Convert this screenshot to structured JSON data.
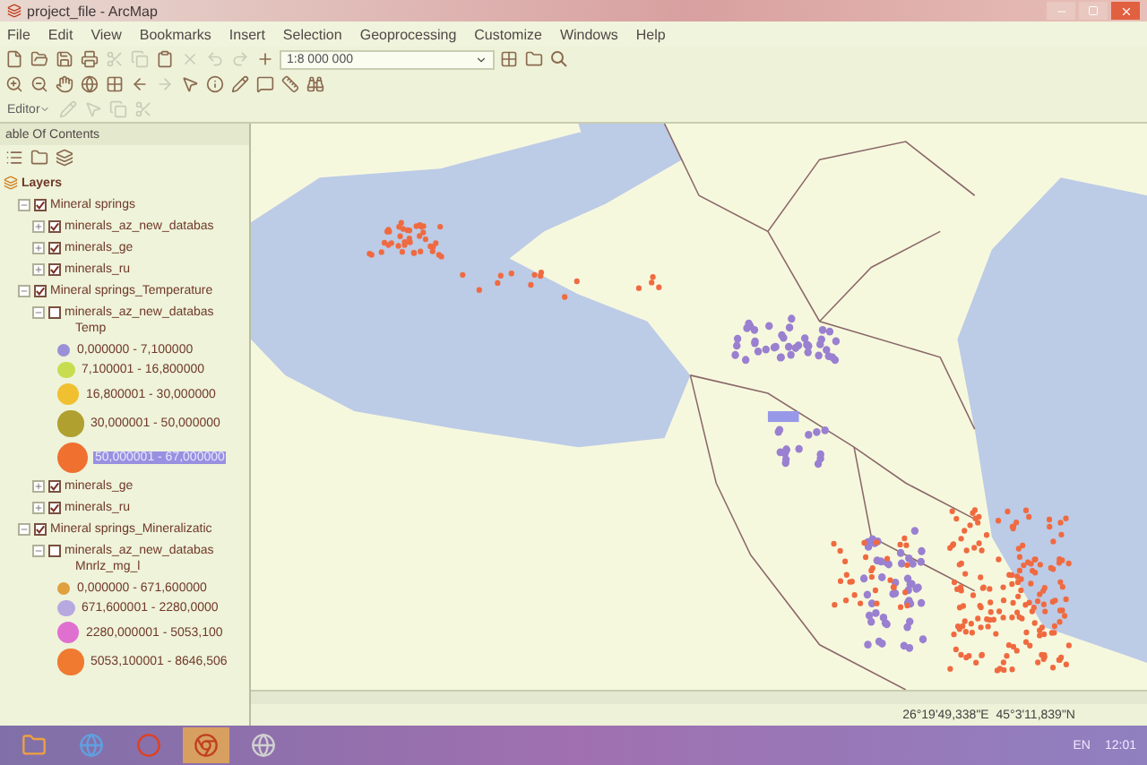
{
  "window": {
    "title": "project_file - ArcMap"
  },
  "menu": [
    "File",
    "Edit",
    "View",
    "Bookmarks",
    "Insert",
    "Selection",
    "Geoprocessing",
    "Customize",
    "Windows",
    "Help"
  ],
  "toolbar": {
    "scale": "1:8 000 000",
    "editor": "Editor"
  },
  "toc": {
    "title": "able Of Contents",
    "root": {
      "label": "Layers",
      "children": [
        {
          "label": "Mineral springs",
          "checked": true,
          "expanded": true,
          "children": [
            {
              "label": "minerals_az_new_databas",
              "checked": true,
              "expanded": false
            },
            {
              "label": "minerals_ge",
              "checked": true,
              "expanded": false
            },
            {
              "label": "minerals_ru",
              "checked": true,
              "expanded": false
            }
          ]
        },
        {
          "label": "Mineral springs_Temperature",
          "checked": true,
          "expanded": true,
          "children": [
            {
              "label": "minerals_az_new_databas",
              "checked": false,
              "expanded": true,
              "legend": {
                "field": "Temp",
                "classes": [
                  {
                    "label": "0,000000 - 7,100000",
                    "color": "#9a90d8",
                    "selected": false
                  },
                  {
                    "label": "7,100001 - 16,800000",
                    "color": "#c8dc50",
                    "selected": false
                  },
                  {
                    "label": "16,800001 - 30,000000",
                    "color": "#f0c030",
                    "selected": false
                  },
                  {
                    "label": "30,000001 - 50,000000",
                    "color": "#b0a030",
                    "selected": false
                  },
                  {
                    "label": "50,000001 - 67,000000",
                    "color": "#f07030",
                    "selected": true
                  }
                ]
              }
            },
            {
              "label": "minerals_ge",
              "checked": true,
              "expanded": false
            },
            {
              "label": "minerals_ru",
              "checked": true,
              "expanded": false
            }
          ]
        },
        {
          "label": "Mineral springs_Mineralizatic",
          "checked": true,
          "expanded": true,
          "children": [
            {
              "label": "minerals_az_new_databas",
              "checked": false,
              "expanded": true,
              "legend": {
                "field": "Mnrlz_mg_l",
                "classes": [
                  {
                    "label": "0,000000 - 671,600000",
                    "color": "#e0a040",
                    "selected": false
                  },
                  {
                    "label": "671,600001 - 2280,0000",
                    "color": "#b8a8e0",
                    "selected": false
                  },
                  {
                    "label": "2280,000001 - 5053,100",
                    "color": "#e070d0",
                    "selected": false
                  },
                  {
                    "label": "5053,100001 - 8646,506",
                    "color": "#f07a30",
                    "selected": false
                  }
                ]
              }
            }
          ]
        }
      ]
    }
  },
  "status": {
    "coordinates": "26°19'49,338\"E  45°3'11,839\"N"
  },
  "taskbar": {
    "language": "EN",
    "time": "12:01"
  }
}
